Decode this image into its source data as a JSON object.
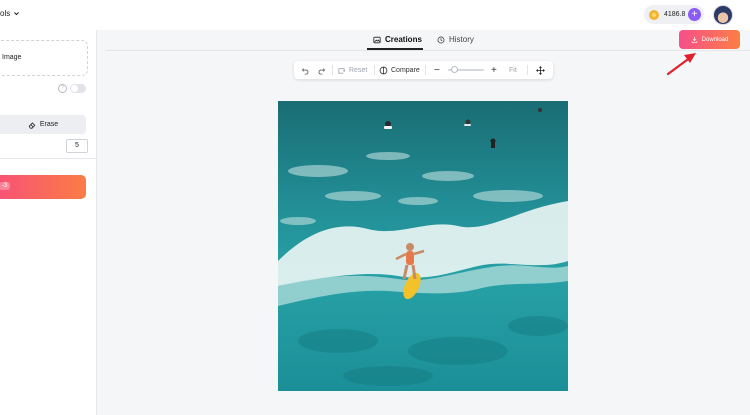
{
  "header": {
    "tools_label": "ols",
    "credits_amount": "4186.8",
    "plus_label": "+"
  },
  "sidebar": {
    "upload_label": "Image",
    "help_glyph": "?",
    "erase_label": "Erase",
    "brush_size_value": "5",
    "generate_badge": "-3"
  },
  "tabs": [
    {
      "label": "Creations",
      "icon": "image-icon",
      "active": true
    },
    {
      "label": "History",
      "icon": "clock-icon",
      "active": false
    }
  ],
  "download": {
    "label": "Download"
  },
  "toolbar": {
    "reset_label": "Reset",
    "compare_label": "Compare",
    "zoom_minus": "−",
    "zoom_plus": "+",
    "fit_label": "Fit"
  },
  "colors": {
    "accent_gradient_start": "#f6508a",
    "accent_gradient_end": "#fb7e44",
    "plus_button": "#8b5cf6",
    "coin": "#f3b431",
    "arrow": "#e0202a"
  }
}
